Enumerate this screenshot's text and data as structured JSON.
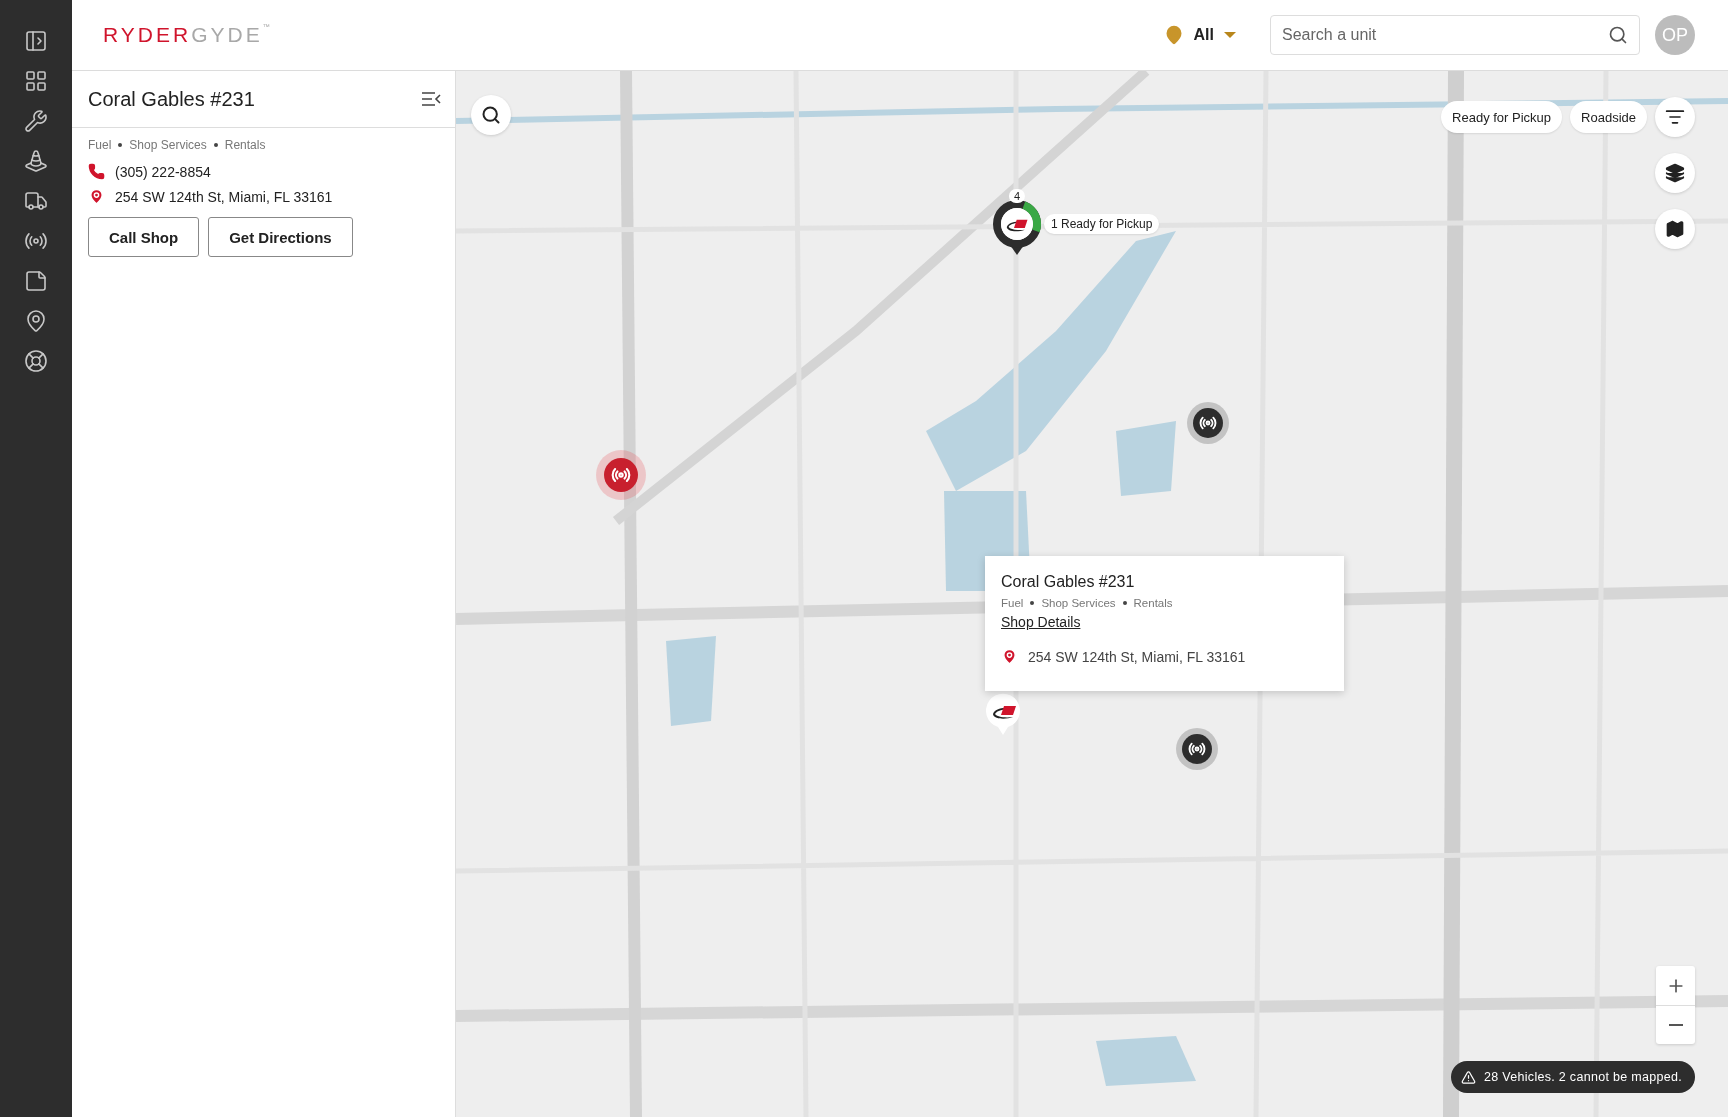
{
  "header": {
    "logo": {
      "primary": "RYDER",
      "secondary": "GYDE",
      "mark": "™"
    },
    "location_filter": {
      "value": "All"
    },
    "search": {
      "placeholder": "Search a unit"
    },
    "avatar": {
      "initials": "OP"
    }
  },
  "shop_panel": {
    "title": "Coral Gables #231",
    "services": [
      "Fuel",
      "Shop Services",
      "Rentals"
    ],
    "phone": "(305) 222-8854",
    "address": "254 SW 124th St, Miami, FL 33161",
    "buttons": [
      "Call Shop",
      "Get Directions"
    ]
  },
  "map": {
    "filter_chips": [
      "Ready for Pickup",
      "Roadside"
    ],
    "markers": [
      {
        "kind": "cluster",
        "count": "4",
        "label": "1 Ready for Pickup"
      },
      {
        "kind": "alert"
      },
      {
        "kind": "signal"
      },
      {
        "kind": "signal"
      },
      {
        "kind": "shop"
      }
    ],
    "popup": {
      "title": "Coral Gables #231",
      "services": [
        "Fuel",
        "Shop Services",
        "Rentals"
      ],
      "link": "Shop Details",
      "address": "254 SW 124th St, Miami, FL 33161"
    },
    "toast": "28 Vehicles. 2 cannot be mapped."
  }
}
